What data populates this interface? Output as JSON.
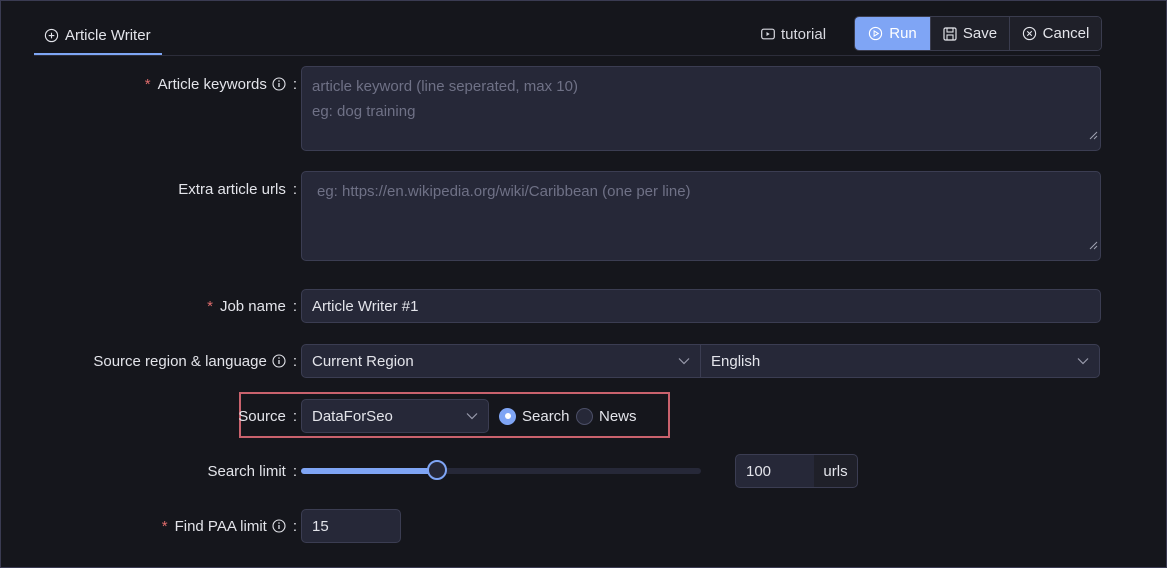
{
  "tab": {
    "label": "Article Writer"
  },
  "toolbar": {
    "tutorial_label": "tutorial",
    "run_label": "Run",
    "save_label": "Save",
    "cancel_label": "Cancel"
  },
  "form": {
    "keywords": {
      "label": "Article keywords",
      "required": "*",
      "placeholder_line1": "article keyword (line seperated, max 10)",
      "placeholder_line2": "eg: dog training"
    },
    "extra_urls": {
      "label": "Extra article urls",
      "placeholder": "eg: https://en.wikipedia.org/wiki/Caribbean (one per line)"
    },
    "job_name": {
      "label": "Job name",
      "required": "*",
      "value": "Article Writer #1"
    },
    "region_language": {
      "label": "Source region & language",
      "region_value": "Current Region",
      "language_value": "English"
    },
    "source": {
      "label": "Source",
      "value": "DataForSeo",
      "options": [
        {
          "label": "Search",
          "checked": true
        },
        {
          "label": "News",
          "checked": false
        }
      ]
    },
    "search_limit": {
      "label": "Search limit",
      "value": "100",
      "unit": "urls",
      "slider_fraction": 0.34
    },
    "paa_limit": {
      "label": "Find PAA limit",
      "required": "*",
      "value": "15"
    },
    "colon": ":"
  },
  "colors": {
    "accent": "#7fa5f5",
    "required": "#e06c6c",
    "highlight": "#c9626d"
  }
}
